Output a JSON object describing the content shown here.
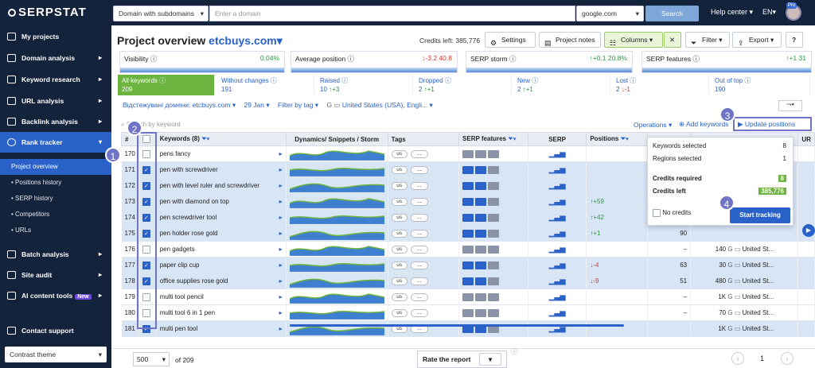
{
  "topbar": {
    "logo": "SERPSTAT",
    "scope": "Domain with subdomains",
    "domain_placeholder": "Enter a domain",
    "engine": "google.com",
    "search": "Search",
    "help": "Help center",
    "lang": "EN",
    "avatar_badge": "Pro"
  },
  "sidebar": {
    "items": [
      {
        "label": "My projects",
        "icon": "home-icon"
      },
      {
        "label": "Domain analysis",
        "icon": "domain-icon"
      },
      {
        "label": "Keyword research",
        "icon": "key-icon"
      },
      {
        "label": "URL analysis",
        "icon": "url-icon"
      },
      {
        "label": "Backlink analysis",
        "icon": "link-icon"
      },
      {
        "label": "Rank tracker",
        "icon": "clock-icon"
      }
    ],
    "sub": [
      "Project overview",
      "Positions history",
      "SERP history",
      "Competitors",
      "URLs"
    ],
    "items2": [
      {
        "label": "Batch analysis"
      },
      {
        "label": "Site audit"
      },
      {
        "label": "AI content tools",
        "badge": "New"
      }
    ],
    "contact": "Contact support",
    "theme": "Contrast theme"
  },
  "header": {
    "title": "Project overview",
    "domain": "etcbuys.com",
    "credits": "Credits left: 385,776",
    "settings": "Settings",
    "notes": "Project notes",
    "columns": "Columns",
    "filter": "Filter",
    "export": "Export",
    "help": "?"
  },
  "cards": [
    {
      "label": "Visibility",
      "value": "0.04%"
    },
    {
      "label": "Average position",
      "delta": "-3.2",
      "value": "40.8"
    },
    {
      "label": "SERP storm",
      "delta": "+0.1",
      "value": "20.8%"
    },
    {
      "label": "SERP features",
      "delta": "+1",
      "value": "31"
    }
  ],
  "tabs": [
    {
      "label": "All keywords",
      "value": "209"
    },
    {
      "label": "Without changes",
      "value": "191"
    },
    {
      "label": "Raised",
      "value": "10",
      "delta": "+3"
    },
    {
      "label": "Dropped",
      "value": "2",
      "delta": "+1"
    },
    {
      "label": "New",
      "value": "2",
      "delta": "+1"
    },
    {
      "label": "Lost",
      "value": "2",
      "delta": "-1"
    },
    {
      "label": "Out of top",
      "value": "190"
    }
  ],
  "filters": {
    "tracked": "Відстежувані домени: etcbuys.com",
    "date": "29 Jan",
    "tag": "Filter by tag",
    "region": "United States (USA), Engli..."
  },
  "toolbar": {
    "search_placeholder": "Search by keyword",
    "operations": "Operations",
    "add_keywords": "Add keywords",
    "update": "Update positions"
  },
  "table": {
    "headers": [
      "#",
      "",
      "Keywords (8)",
      "Dynamics/ Snippets / Storm",
      "Tags",
      "SERP features",
      "SERP",
      "Positions",
      "",
      "",
      "UR"
    ],
    "rows": [
      {
        "n": "170",
        "kw": "pens fancy",
        "sel": false,
        "pos": "",
        "pd": "",
        "cur": "",
        "vol": "",
        "reg": ""
      },
      {
        "n": "171",
        "kw": "pen with screwdriver",
        "sel": true,
        "pos": "",
        "pd": "",
        "cur": "",
        "vol": "",
        "reg": ""
      },
      {
        "n": "172",
        "kw": "pen with level ruler and screwdriver",
        "sel": true,
        "pos": "",
        "pd": "",
        "cur": "",
        "vol": "",
        "reg": ""
      },
      {
        "n": "173",
        "kw": "pen with diamond on top",
        "sel": true,
        "pos": "+59",
        "pd": "up",
        "cur": "",
        "vol": "",
        "reg": ""
      },
      {
        "n": "174",
        "kw": "pen screwdriver tool",
        "sel": true,
        "pos": "+42",
        "pd": "up",
        "cur": "",
        "vol": "",
        "reg": ""
      },
      {
        "n": "175",
        "kw": "pen holder rose gold",
        "sel": true,
        "pos": "+1",
        "pd": "up",
        "cur": "90",
        "vol": "",
        "reg": ""
      },
      {
        "n": "176",
        "kw": "pen gadgets",
        "sel": false,
        "pos": "",
        "pd": "",
        "cur": "–",
        "vol": "140",
        "reg": "United St..."
      },
      {
        "n": "177",
        "kw": "paper clip cup",
        "sel": true,
        "pos": "-4",
        "pd": "dn",
        "cur": "63",
        "vol": "30",
        "reg": "United St..."
      },
      {
        "n": "178",
        "kw": "office supplies rose gold",
        "sel": true,
        "pos": "-9",
        "pd": "dn",
        "cur": "51",
        "vol": "480",
        "reg": "United St..."
      },
      {
        "n": "179",
        "kw": "multi tool pencil",
        "sel": false,
        "pos": "",
        "pd": "",
        "cur": "–",
        "vol": "1K",
        "reg": "United St..."
      },
      {
        "n": "180",
        "kw": "multi tool 6 in 1 pen",
        "sel": false,
        "pos": "",
        "pd": "",
        "cur": "–",
        "vol": "70",
        "reg": "United St..."
      },
      {
        "n": "181",
        "kw": "multi pen tool",
        "sel": true,
        "pos": "",
        "pd": "",
        "cur": "",
        "vol": "1K",
        "reg": "United St..."
      }
    ]
  },
  "popup": {
    "kw_label": "Keywords selected",
    "kw": "8",
    "reg_label": "Regions selected",
    "reg": "1",
    "req_label": "Credits required",
    "req": "8",
    "left_label": "Credits left",
    "left": "385,776",
    "no_credits": "No credits",
    "start": "Start tracking"
  },
  "markers": [
    "1",
    "2",
    "3",
    "4"
  ],
  "footer": {
    "per_page": "500",
    "of": "of 209",
    "rate": "Rate the report",
    "page": "1"
  },
  "tag_us": "us",
  "tag_more": "..."
}
